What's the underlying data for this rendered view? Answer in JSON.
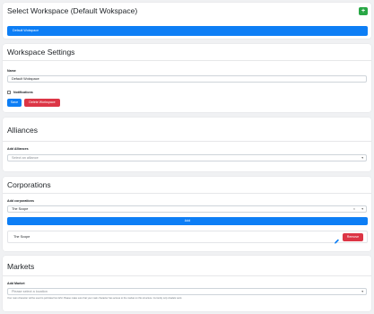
{
  "select_workspace": {
    "title": "Select Workspace (Default Wokspace)",
    "add_label": "+",
    "selected": "Default Wokspace"
  },
  "workspace_settings": {
    "title": "Workspace Settings",
    "name_label": "Name",
    "name_value": "Default Wokspace",
    "notifications_label": "Notifications",
    "save_label": "Save",
    "delete_label": "Delete Workspace"
  },
  "alliances": {
    "title": "Alliances",
    "add_label": "Add Alliances",
    "placeholder": "Select an alliance"
  },
  "corporations": {
    "title": "Corporations",
    "add_label": "Add corporations",
    "selected_chip": "The Scope",
    "add_button": "Add",
    "items": [
      {
        "name": "The Scope",
        "remove_label": "Remove"
      }
    ]
  },
  "markets": {
    "title": "Markets",
    "add_label": "Add Market",
    "placeholder": "Please select a location",
    "help_text": "Your main character will be used to pull data from ESI. Please make sure that your main character has access to the market on this structure. Currently only citadels work."
  },
  "colors": {
    "primary": "#0d7ef5",
    "danger": "#dc3545",
    "success": "#28a745",
    "page_bg": "#f0f1f3"
  }
}
